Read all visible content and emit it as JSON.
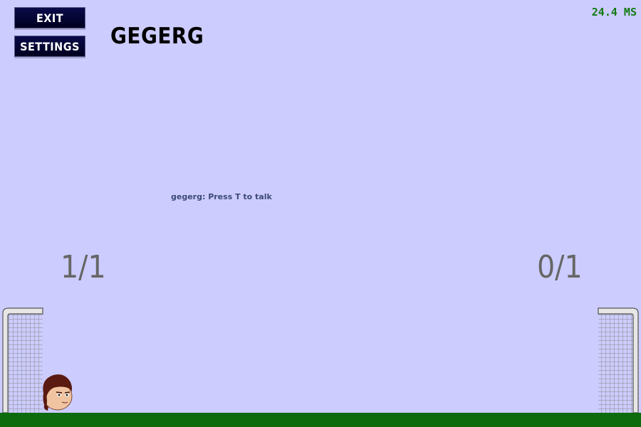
{
  "menu": {
    "exit_label": "EXIT",
    "settings_label": "SETTINGS"
  },
  "player": {
    "name": "GEGERG"
  },
  "status": {
    "ping": "24.4 MS"
  },
  "chat": {
    "message": "gegerg: Press T to talk"
  },
  "scores": {
    "left": "1/1",
    "right": "0/1"
  },
  "colors": {
    "sky": "#ccccff",
    "ground": "#0d6a0d",
    "button": "#000033",
    "ping": "#147a14",
    "score": "#666666"
  },
  "icons": {
    "left_goal": "goal-net-icon",
    "right_goal": "goal-net-icon",
    "player": "player-head-icon"
  }
}
